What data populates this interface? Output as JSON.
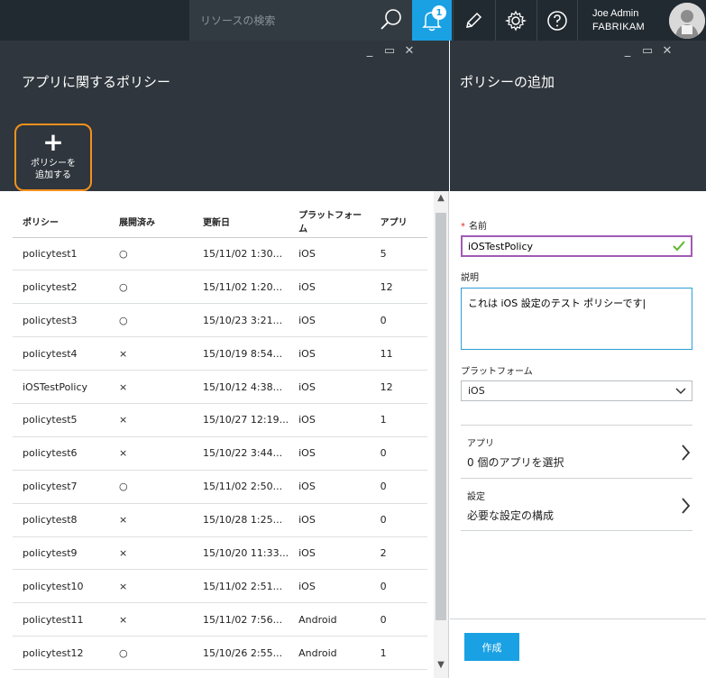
{
  "topbar": {
    "search_placeholder": "リソースの検索",
    "notification_count": "1",
    "user_name": "Joe Admin",
    "user_org": "FABRIKAM"
  },
  "left_blade": {
    "title": "アプリに関するポリシー",
    "add_button_label": "ポリシーを\n追加する",
    "columns": [
      "ポリシー",
      "展開済み",
      "更新日",
      "プラットフォーム",
      "アプリ"
    ],
    "rows": [
      {
        "name": "policytest1",
        "deployed": "○",
        "updated": "15/11/02 1:30...",
        "platform": "iOS",
        "apps": "5"
      },
      {
        "name": "policytest2",
        "deployed": "○",
        "updated": "15/11/02 1:20...",
        "platform": "iOS",
        "apps": "12"
      },
      {
        "name": "policytest3",
        "deployed": "○",
        "updated": "15/10/23 3:21...",
        "platform": "iOS",
        "apps": "0"
      },
      {
        "name": "policytest4",
        "deployed": "×",
        "updated": "15/10/19 8:54...",
        "platform": "iOS",
        "apps": "11"
      },
      {
        "name": "iOSTestPolicy",
        "deployed": "×",
        "updated": "15/10/12 4:38...",
        "platform": "iOS",
        "apps": "12"
      },
      {
        "name": "policytest5",
        "deployed": "×",
        "updated": "15/10/27 12:19...",
        "platform": "iOS",
        "apps": "1"
      },
      {
        "name": "policytest6",
        "deployed": "×",
        "updated": "15/10/22 3:44...",
        "platform": "iOS",
        "apps": "0"
      },
      {
        "name": "policytest7",
        "deployed": "○",
        "updated": "15/11/02 2:50...",
        "platform": "iOS",
        "apps": "0"
      },
      {
        "name": "policytest8",
        "deployed": "×",
        "updated": "15/10/28 1:25...",
        "platform": "iOS",
        "apps": "0"
      },
      {
        "name": "policytest9",
        "deployed": "×",
        "updated": "15/10/20 11:33...",
        "platform": "iOS",
        "apps": "2"
      },
      {
        "name": "policytest10",
        "deployed": "×",
        "updated": "15/11/02 2:51...",
        "platform": "iOS",
        "apps": "0"
      },
      {
        "name": "policytest11",
        "deployed": "×",
        "updated": "15/11/02 7:56...",
        "platform": "Android",
        "apps": "0"
      },
      {
        "name": "policytest12",
        "deployed": "○",
        "updated": "15/10/26 2:55...",
        "platform": "Android",
        "apps": "1"
      }
    ]
  },
  "right_blade": {
    "title": "ポリシーの追加",
    "name_label": "名前",
    "name_value": "iOSTestPolicy",
    "description_label": "説明",
    "description_value": "これは iOS 設定のテスト ポリシーです|",
    "platform_label": "プラットフォーム",
    "platform_value": "iOS",
    "apps_label": "アプリ",
    "apps_value": "0 個のアプリを選択",
    "settings_label": "設定",
    "settings_value": "必要な設定の構成",
    "create_button": "作成"
  },
  "colors": {
    "accent": "#19a1e4",
    "highlight": "#f6911e",
    "header_dark": "#222a31",
    "blade_header": "#2f363d",
    "valid_border": "#a05bb5",
    "check_green": "#5cb82e",
    "required_star": "#e02b1c"
  },
  "icons": [
    "search-icon",
    "bell-icon",
    "pencil-icon",
    "gear-icon",
    "help-icon",
    "minimize-icon",
    "maximize-icon",
    "close-icon",
    "plus-icon",
    "check-icon",
    "chevron-down-icon",
    "chevron-right-icon"
  ]
}
